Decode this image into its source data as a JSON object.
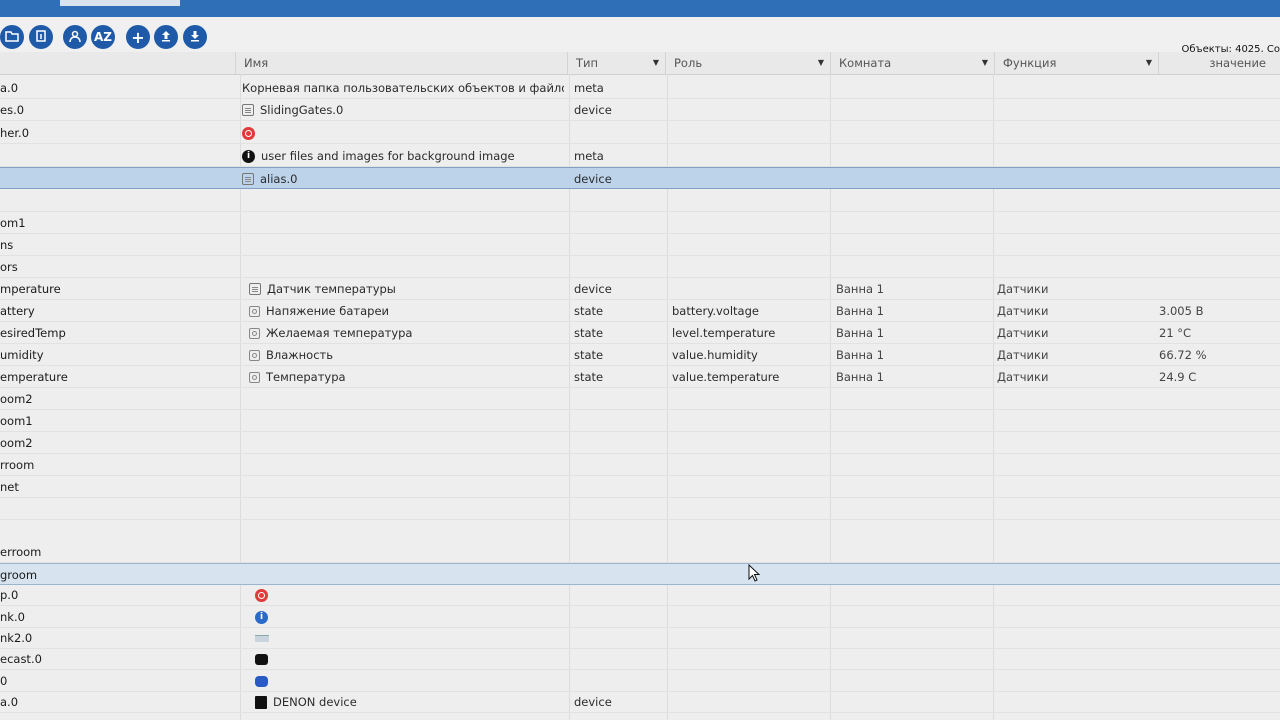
{
  "toolbar": {
    "buttons": [
      {
        "id": "folder",
        "label": "",
        "icon": "folder-icon"
      },
      {
        "id": "doc",
        "label": "",
        "icon": "document-icon"
      },
      {
        "id": "user",
        "label": "",
        "icon": "user-icon"
      },
      {
        "id": "sort",
        "label": "AZ",
        "icon": "sort-az-icon"
      },
      {
        "id": "add",
        "label": "+",
        "icon": "plus-icon"
      },
      {
        "id": "upload",
        "label": "",
        "icon": "upload-icon"
      },
      {
        "id": "download",
        "label": "",
        "icon": "download-icon"
      }
    ],
    "object_count": "Объекты: 4025, Со"
  },
  "columns": {
    "name": "Имя",
    "type": "Тип",
    "role": "Роль",
    "room": "Комната",
    "function": "Функция",
    "value": "значение"
  },
  "rows": [
    {
      "id": "a.0",
      "name": "Корневая папка пользовательских объектов и файлов",
      "icon": "",
      "type": "meta"
    },
    {
      "id": "es.0",
      "name": "SlidingGates.0",
      "icon": "device-icon",
      "type": "device"
    },
    {
      "id": "her.0",
      "name": "",
      "icon": "record-red-icon",
      "type": ""
    },
    {
      "id": "",
      "name": "user files and images for background image",
      "icon": "info-icon",
      "type": "meta"
    },
    {
      "id": "",
      "name": "alias.0",
      "icon": "device-icon",
      "type": "device"
    },
    {
      "id": "",
      "name": "",
      "icon": "",
      "type": ""
    },
    {
      "id": "om1",
      "name": "",
      "icon": "",
      "type": ""
    },
    {
      "id": "ns",
      "name": "",
      "icon": "",
      "type": ""
    },
    {
      "id": "ors",
      "name": "",
      "icon": "",
      "type": ""
    },
    {
      "id": "mperature",
      "name": "Датчик температуры",
      "icon": "device-icon",
      "type": "device",
      "role": "",
      "room": "Ванна 1",
      "function": "Датчики",
      "value": ""
    },
    {
      "id": "attery",
      "name": "Напяжение батареи",
      "icon": "state-icon",
      "type": "state",
      "role": "battery.voltage",
      "room": "Ванна 1",
      "function": "Датчики",
      "value": "3.005 В"
    },
    {
      "id": "esiredTemp",
      "name": "Желаемая температура",
      "icon": "state-icon",
      "type": "state",
      "role": "level.temperature",
      "room": "Ванна 1",
      "function": "Датчики",
      "value": "21 °C"
    },
    {
      "id": "umidity",
      "name": "Влажность",
      "icon": "state-icon",
      "type": "state",
      "role": "value.humidity",
      "room": "Ванна 1",
      "function": "Датчики",
      "value": "66.72 %"
    },
    {
      "id": "emperature",
      "name": "Температура",
      "icon": "state-icon",
      "type": "state",
      "role": "value.temperature",
      "room": "Ванна 1",
      "function": "Датчики",
      "value": "24.9 C"
    },
    {
      "id": "oom2",
      "name": "",
      "icon": "",
      "type": ""
    },
    {
      "id": "oom1",
      "name": "",
      "icon": "",
      "type": ""
    },
    {
      "id": "oom2",
      "name": "",
      "icon": "",
      "type": ""
    },
    {
      "id": "rroom",
      "name": "",
      "icon": "",
      "type": ""
    },
    {
      "id": "net",
      "name": "",
      "icon": "",
      "type": ""
    },
    {
      "id": "",
      "name": "",
      "icon": "",
      "type": ""
    },
    {
      "id": "erroom",
      "name": "",
      "icon": "",
      "type": ""
    },
    {
      "id": "groom",
      "name": "",
      "icon": "",
      "type": ""
    },
    {
      "id": "p.0",
      "name": "",
      "icon": "record-red-icon",
      "type": ""
    },
    {
      "id": "nk.0",
      "name": "",
      "icon": "info-blue-icon",
      "type": ""
    },
    {
      "id": "nk2.0",
      "name": "",
      "icon": "pipe-icon",
      "type": ""
    },
    {
      "id": "ecast.0",
      "name": "",
      "icon": "camera-icon",
      "type": ""
    },
    {
      "id": "0",
      "name": "",
      "icon": "cloud-icon",
      "type": ""
    },
    {
      "id": "a.0",
      "name": "DENON device",
      "icon": "denon-icon",
      "type": "device"
    }
  ]
}
